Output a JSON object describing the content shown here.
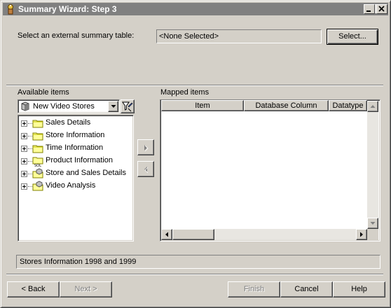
{
  "window": {
    "title": "Summary Wizard: Step 3"
  },
  "summary_table": {
    "label": "Select an external summary table:",
    "value": "<None Selected>",
    "select_button": "Select..."
  },
  "available": {
    "label": "Available items",
    "dropdown_value": "New Video Stores",
    "items": [
      {
        "label": "Sales Details",
        "icon": "folder-icon"
      },
      {
        "label": "Store Information",
        "icon": "folder-icon"
      },
      {
        "label": "Time Information",
        "icon": "folder-icon"
      },
      {
        "label": "Product Information",
        "icon": "sql-folder-icon"
      },
      {
        "label": "Store and Sales Details",
        "icon": "folder-cube-icon"
      },
      {
        "label": "Video Analysis",
        "icon": "folder-cube-icon"
      }
    ]
  },
  "mapped": {
    "label": "Mapped items",
    "columns": [
      "Item",
      "Database Column",
      "Datatype"
    ]
  },
  "status_text": "Stores Information 1998 and 1999",
  "buttons": {
    "back": "< Back",
    "next": "Next >",
    "finish": "Finish",
    "cancel": "Cancel",
    "help": "Help"
  },
  "colors": {
    "face": "#d4d0c8",
    "title_inactive": "#808080",
    "folder": "#ffff99"
  }
}
